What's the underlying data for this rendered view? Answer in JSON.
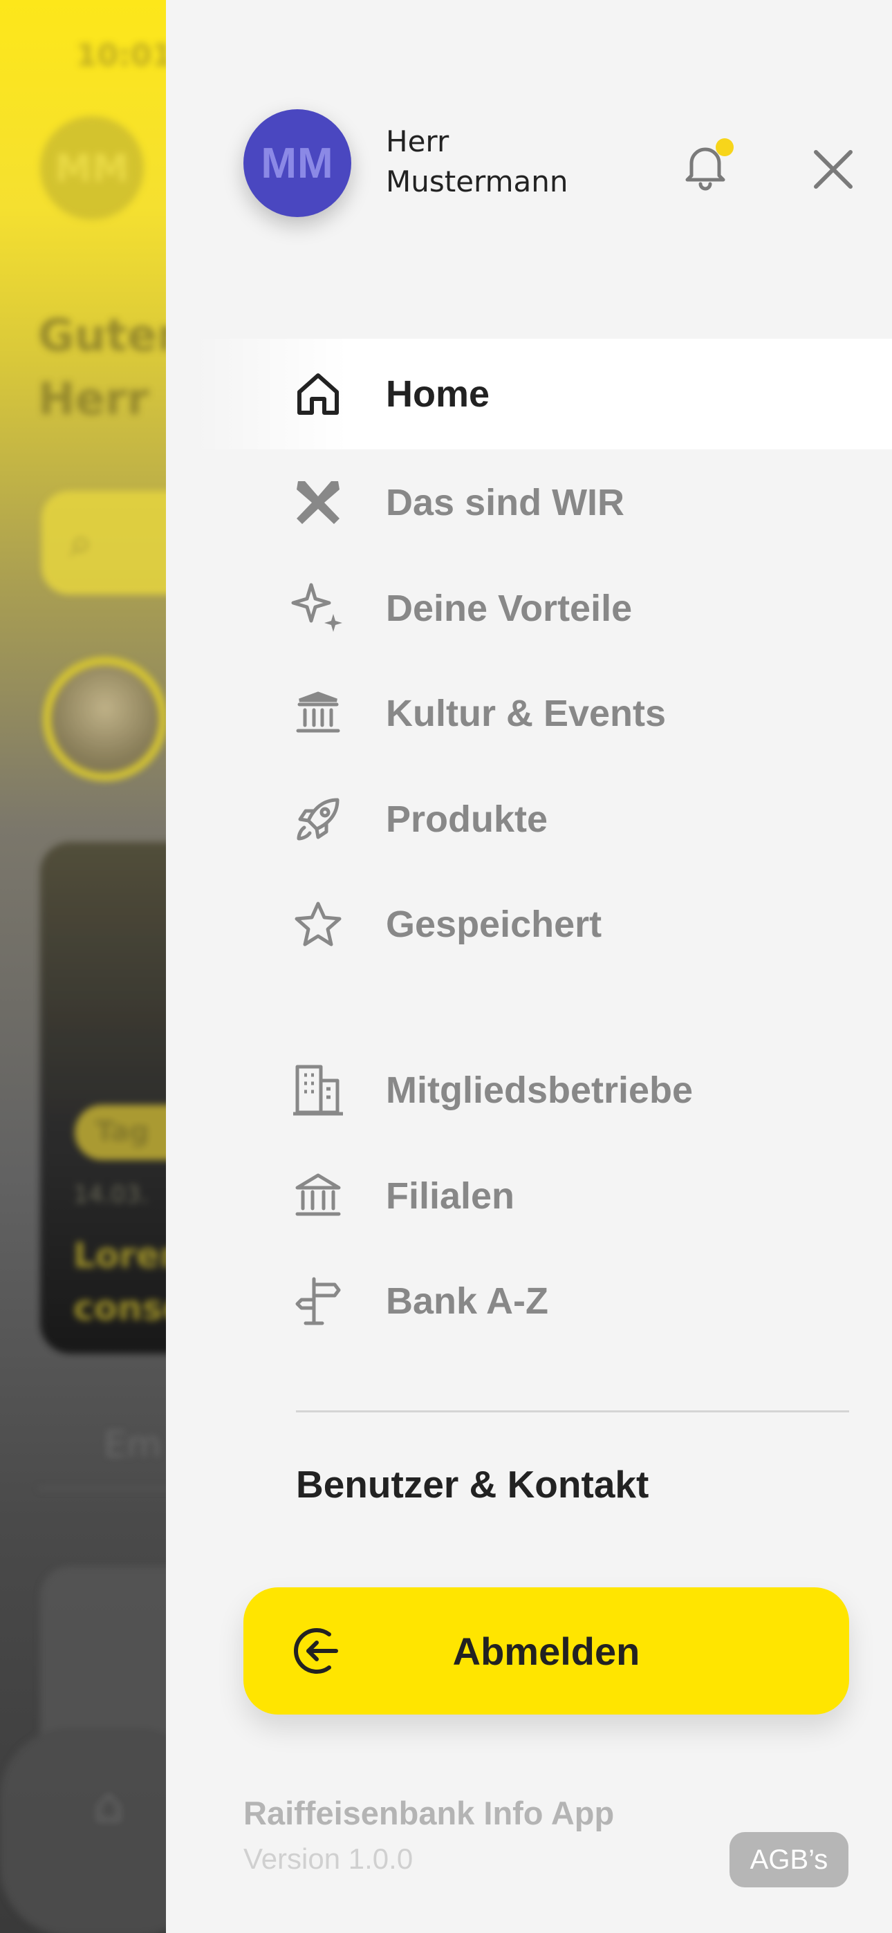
{
  "background_app": {
    "time": "10:01",
    "avatar_initials": "MM",
    "greeting_line1": "Guten",
    "greeting_line2": "Herr",
    "card_tag": "Tag",
    "card_date": "14.03.",
    "card_text_line1": "Lorem",
    "card_text_line2": "conse",
    "tab_label": "Em"
  },
  "drawer": {
    "user": {
      "initials": "MM",
      "name_line1": "Herr",
      "name_line2": "Mustermann",
      "avatar_color": "#4a47c0"
    },
    "notification_dot_color": "#f7d51b",
    "menu": [
      {
        "label": "Home",
        "icon": "home-icon",
        "active": true
      },
      {
        "label": "Das sind WIR",
        "icon": "raiffeisen-crossed-icon",
        "active": false
      },
      {
        "label": "Deine Vorteile",
        "icon": "sparkles-icon",
        "active": false
      },
      {
        "label": "Kultur & Events",
        "icon": "museum-icon",
        "active": false
      },
      {
        "label": "Produkte",
        "icon": "rocket-icon",
        "active": false
      },
      {
        "label": "Gespeichert",
        "icon": "star-icon",
        "active": false
      },
      {
        "label": "Mitgliedsbetriebe",
        "icon": "building-icon",
        "active": false
      },
      {
        "label": "Filialen",
        "icon": "bank-icon",
        "active": false
      },
      {
        "label": "Bank A-Z",
        "icon": "signpost-icon",
        "active": false
      }
    ],
    "contact_label": "Benutzer & Kontakt",
    "logout_label": "Abmelden",
    "accent_color": "#ffe500",
    "app_name": "Raiffeisenbank Info App",
    "app_version": "Version 1.0.0",
    "agb_label": "AGB’s"
  }
}
